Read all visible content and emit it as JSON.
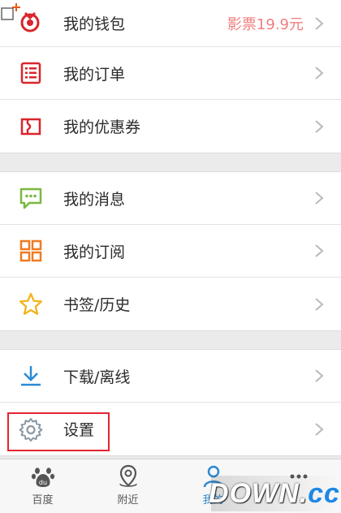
{
  "menu": {
    "section1": [
      {
        "id": "wallet",
        "label": "我的钱包",
        "value": "影票19.9元",
        "icon": "wallet-icon"
      },
      {
        "id": "orders",
        "label": "我的订单",
        "icon": "order-list-icon"
      },
      {
        "id": "coupons",
        "label": "我的优惠券",
        "icon": "coupon-icon"
      }
    ],
    "section2": [
      {
        "id": "messages",
        "label": "我的消息",
        "icon": "message-icon"
      },
      {
        "id": "subscriptions",
        "label": "我的订阅",
        "icon": "grid-icon"
      },
      {
        "id": "bookmarks",
        "label": "书签/历史",
        "icon": "star-icon"
      }
    ],
    "section3": [
      {
        "id": "downloads",
        "label": "下载/离线",
        "icon": "download-icon"
      },
      {
        "id": "settings",
        "label": "设置",
        "icon": "gear-icon"
      }
    ]
  },
  "tabbar": {
    "tabs": [
      {
        "id": "baidu",
        "label": "百度",
        "icon": "paw-icon"
      },
      {
        "id": "nearby",
        "label": "附近",
        "icon": "location-pin-icon"
      },
      {
        "id": "mine",
        "label": "我的",
        "icon": "person-icon"
      },
      {
        "id": "more",
        "label": "",
        "icon": "more-icon"
      }
    ]
  },
  "watermark": {
    "main": "DOWN.",
    "suffix": "cc"
  },
  "colors": {
    "wallet_value": "#f07e7e",
    "icon_red": "#d9252b",
    "icon_green": "#7ab840",
    "icon_orange": "#f07a1f",
    "icon_gold": "#f3b31c",
    "icon_blue": "#2a8ad5",
    "icon_gray": "#8a9aa6",
    "highlight": "#e4252f"
  }
}
